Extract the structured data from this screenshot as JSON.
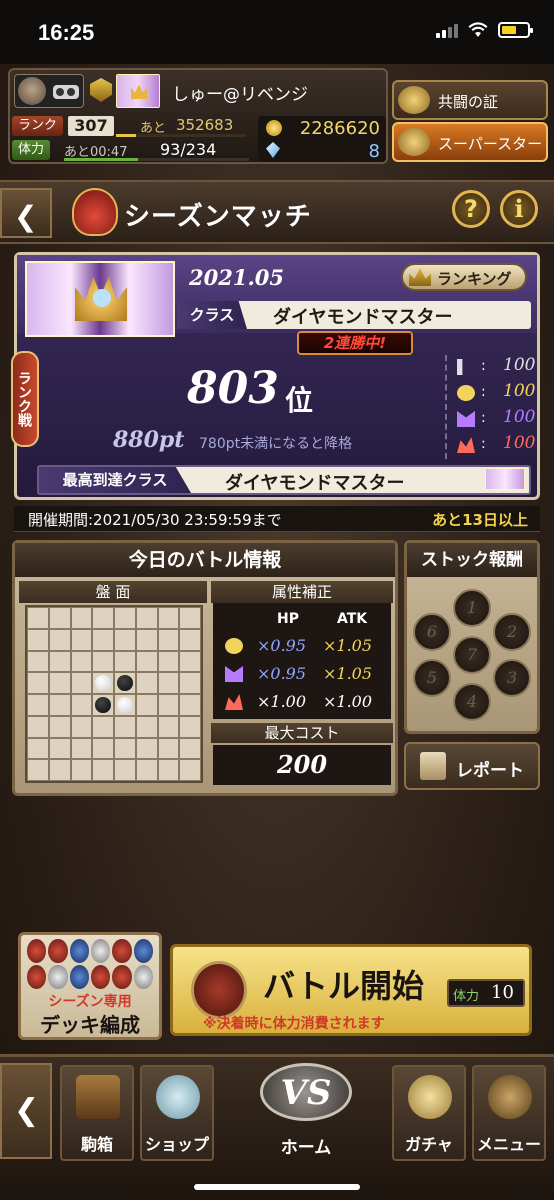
{
  "status_bar": {
    "time": "16:25"
  },
  "player": {
    "name": "しゅー@リベンジ",
    "rank_label": "ランク",
    "rank": "307",
    "exp_label": "あと",
    "exp_remaining": "352683",
    "exp_fraction": 0.15,
    "stamina_label": "体力",
    "stamina_timer": "あと00:47",
    "stamina": "93/234",
    "stamina_fraction": 0.4,
    "coins": "2286620",
    "gems": "8"
  },
  "side_buttons": {
    "kyoto": "共闘の証",
    "superstar": "スーパースター"
  },
  "header": {
    "title": "シーズンマッチ",
    "help": "?",
    "info": "i"
  },
  "season": {
    "date": "2021.05",
    "ranking_label": "ランキング",
    "class_label": "クラス",
    "class_value": "ダイヤモンドマスター",
    "streak": "2連勝中!",
    "rank_tab": "ランク戦",
    "rank_position": "803",
    "rank_unit": "位",
    "points": "880pt",
    "points_note": "780pt未満になると降格",
    "attributes": [
      {
        "icon": "neutral-attribute-icon",
        "color": "#e0e0e0",
        "value": "100"
      },
      {
        "icon": "light-attribute-icon",
        "color": "#f2d45a",
        "value": "100"
      },
      {
        "icon": "dark-attribute-icon",
        "color": "#b57cff",
        "value": "100"
      },
      {
        "icon": "fire-attribute-icon",
        "color": "#ff6a5a",
        "value": "100"
      }
    ],
    "best_class_label": "最高到達クラス",
    "best_class_value": "ダイヤモンドマスター",
    "period": "開催期間:2021/05/30 23:59:59まで",
    "remaining": "あと13日以上"
  },
  "battle_info": {
    "title": "今日のバトル情報",
    "board_label": "盤 面",
    "attr_label": "属性補正",
    "hp_label": "HP",
    "atk_label": "ATK",
    "attr_rows": [
      {
        "icon": "light-attribute-icon",
        "color": "#f2d45a",
        "hp": "×0.95",
        "atk": "×1.05"
      },
      {
        "icon": "dark-attribute-icon",
        "color": "#b57cff",
        "hp": "×0.95",
        "atk": "×1.05"
      },
      {
        "icon": "fire-attribute-icon",
        "color": "#ff6a5a",
        "hp": "×1.00",
        "atk": "×1.00"
      }
    ],
    "cost_label": "最大コスト",
    "cost_value": "200",
    "board": {
      "size": 8,
      "discs": [
        {
          "row": 3,
          "col": 3,
          "color": "white"
        },
        {
          "row": 3,
          "col": 4,
          "color": "black"
        },
        {
          "row": 4,
          "col": 3,
          "color": "black"
        },
        {
          "row": 4,
          "col": 4,
          "color": "white"
        }
      ]
    }
  },
  "stock": {
    "title": "ストック報酬",
    "slots": [
      "1",
      "2",
      "3",
      "4",
      "5",
      "6",
      "7"
    ],
    "report_label": "レポート"
  },
  "actions": {
    "deck_sub": "シーズン専用",
    "deck_main": "デッキ編成",
    "battle_start": "バトル開始",
    "battle_note": "※決着時に体力消費されます",
    "stamina_label": "体力",
    "stamina_cost": "10"
  },
  "nav": {
    "items": [
      "駒箱",
      "ショップ",
      "ホーム",
      "ガチャ",
      "メニュー"
    ],
    "vs": "VS"
  }
}
